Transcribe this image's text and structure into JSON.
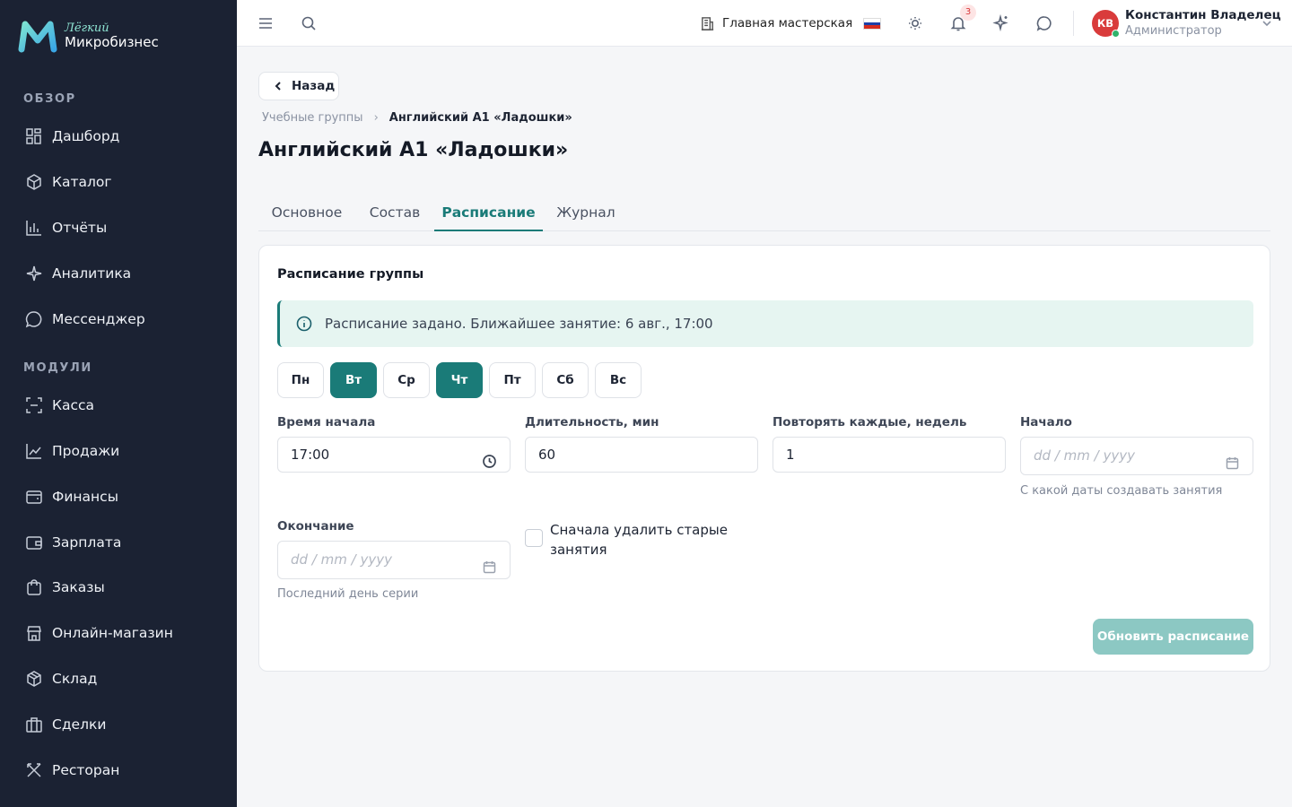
{
  "brand": {
    "tagline": "Лёгкий",
    "name": "Микробизнес"
  },
  "sidebar": {
    "sections": [
      {
        "label": "ОБЗОР"
      },
      {
        "label": "МОДУЛИ"
      }
    ],
    "items": [
      {
        "label": "Дашборд",
        "icon": "dashboard-icon"
      },
      {
        "label": "Каталог",
        "icon": "catalog-icon"
      },
      {
        "label": "Отчёты",
        "icon": "reports-icon"
      },
      {
        "label": "Аналитика",
        "icon": "analytics-icon"
      },
      {
        "label": "Мессенджер",
        "icon": "messenger-icon"
      },
      {
        "label": "Касса",
        "icon": "cash-register-icon"
      },
      {
        "label": "Продажи",
        "icon": "sales-icon"
      },
      {
        "label": "Финансы",
        "icon": "finance-icon"
      },
      {
        "label": "Зарплата",
        "icon": "salary-icon"
      },
      {
        "label": "Заказы",
        "icon": "orders-icon"
      },
      {
        "label": "Онлайн-магазин",
        "icon": "store-icon"
      },
      {
        "label": "Склад",
        "icon": "warehouse-icon"
      },
      {
        "label": "Сделки",
        "icon": "deals-icon"
      },
      {
        "label": "Ресторан",
        "icon": "restaurant-icon"
      }
    ]
  },
  "topbar": {
    "workshop": "Главная мастерская",
    "notifications_count": "3",
    "language": "ru",
    "user": {
      "initials": "КВ",
      "name": "Константин Владелец",
      "role": "Администратор"
    }
  },
  "page": {
    "back_label": "Назад",
    "breadcrumb": [
      "Учебные группы",
      "Английский А1 «Ладошки»"
    ],
    "title": "Английский А1 «Ладошки»",
    "tabs": [
      {
        "label": "Основное",
        "active": false
      },
      {
        "label": "Состав",
        "active": false
      },
      {
        "label": "Расписание",
        "active": true
      },
      {
        "label": "Журнал",
        "active": false
      }
    ]
  },
  "schedule": {
    "title": "Расписание группы",
    "alert": "Расписание задано. Ближайшее занятие: 6 авг., 17:00",
    "days": [
      {
        "label": "Пн",
        "selected": false
      },
      {
        "label": "Вт",
        "selected": true
      },
      {
        "label": "Ср",
        "selected": false
      },
      {
        "label": "Чт",
        "selected": true
      },
      {
        "label": "Пт",
        "selected": false
      },
      {
        "label": "Сб",
        "selected": false
      },
      {
        "label": "Вс",
        "selected": false
      }
    ],
    "start_time": {
      "label": "Время начала",
      "value": "17:00"
    },
    "duration": {
      "label": "Длительность, мин",
      "value": "60"
    },
    "repeat": {
      "label": "Повторять каждые, недель",
      "value": "1"
    },
    "start_date": {
      "label": "Начало",
      "placeholder": "dd /  mm /  yyyy",
      "hint": "С какой даты создавать занятия"
    },
    "end_date": {
      "label": "Окончание",
      "placeholder": "dd /  mm /  yyyy",
      "hint": "Последний день серии"
    },
    "delete_old": {
      "label": "Сначала удалить старые занятия",
      "checked": false
    },
    "submit_label": "Обновить расписание"
  },
  "colors": {
    "sidebar_bg": "#1b2233",
    "accent": "#1a7b78",
    "accent_disabled": "#8cc8c3",
    "alert_bg": "#e6f5f1",
    "badge": "#d8383a",
    "avatar": "#d93b3b"
  }
}
